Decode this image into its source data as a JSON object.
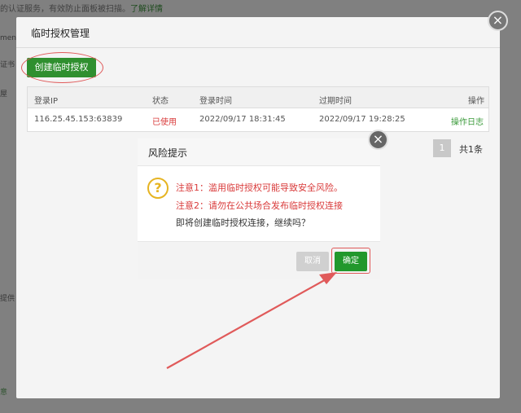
{
  "background": {
    "top_text": "的认证服务，有效防止面板被扫描。",
    "top_link": "了解详情",
    "side_labels": [
      "ment",
      "证书",
      "屋",
      "提供"
    ],
    "bottom_label": "意"
  },
  "main_modal": {
    "title": "临时授权管理",
    "close_label": "×",
    "create_button": "创建临时授权",
    "table": {
      "headers": {
        "ip": "登录IP",
        "status": "状态",
        "login_time": "登录时间",
        "expire_time": "过期时间",
        "action": "操作"
      },
      "rows": [
        {
          "ip": "116.25.45.153:63839",
          "status": "已使用",
          "login_time": "2022/09/17 18:31:45",
          "expire_time": "2022/09/17 19:28:25",
          "action": "操作日志"
        }
      ]
    },
    "pager": {
      "page": "1",
      "total": "共1条"
    }
  },
  "risk_dialog": {
    "title": "风险提示",
    "close_label": "×",
    "icon": "question-icon",
    "icon_glyph": "?",
    "line1": "注意1：滥用临时授权可能导致安全风险。",
    "line2": "注意2：请勿在公共场合发布临时授权连接",
    "line3": "即将创建临时授权连接，继续吗？",
    "cancel_label": "取消",
    "ok_label": "确定"
  },
  "colors": {
    "primary_green": "#22982c",
    "danger_red": "#d93a3a",
    "warning_yellow": "#e6b422",
    "annotation_red": "#e05a5a"
  }
}
